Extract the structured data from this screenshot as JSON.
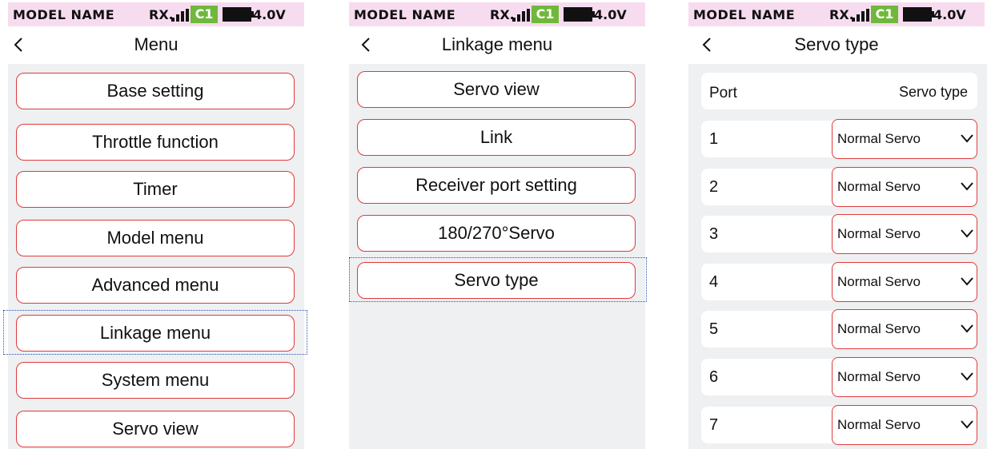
{
  "status_bar": {
    "model_name": "MODEL NAME",
    "rx": "RX.",
    "channel_badge": "C1",
    "voltage": "4.0V",
    "badge_color": "#6fb83b",
    "bar_color": "#f7dcef"
  },
  "screens": [
    {
      "title": "Menu",
      "buttons": [
        "Base setting",
        "Throttle function",
        "Timer",
        "Model menu",
        "Advanced menu",
        "Linkage menu",
        "System menu",
        "Servo view"
      ],
      "selected": "Linkage menu"
    },
    {
      "title": "Linkage menu",
      "buttons": [
        "Servo view",
        "Link",
        "Receiver port setting",
        "180/270°Servo",
        "Servo type"
      ],
      "selected": "Servo type"
    },
    {
      "title": "Servo type",
      "table": {
        "headers": [
          "Port",
          "Servo type"
        ],
        "rows": [
          {
            "port": "1",
            "type": "Normal Servo"
          },
          {
            "port": "2",
            "type": "Normal Servo"
          },
          {
            "port": "3",
            "type": "Normal Servo"
          },
          {
            "port": "4",
            "type": "Normal Servo"
          },
          {
            "port": "5",
            "type": "Normal Servo"
          },
          {
            "port": "6",
            "type": "Normal Servo"
          },
          {
            "port": "7",
            "type": "Normal Servo"
          }
        ]
      }
    }
  ],
  "accent_color": "#e03a3a",
  "selection_color": "#2a4fa8",
  "icons": {
    "back": "chevron-left-icon",
    "dropdown": "chevron-down-icon",
    "signal": "signal-bars-icon",
    "battery": "battery-icon"
  }
}
